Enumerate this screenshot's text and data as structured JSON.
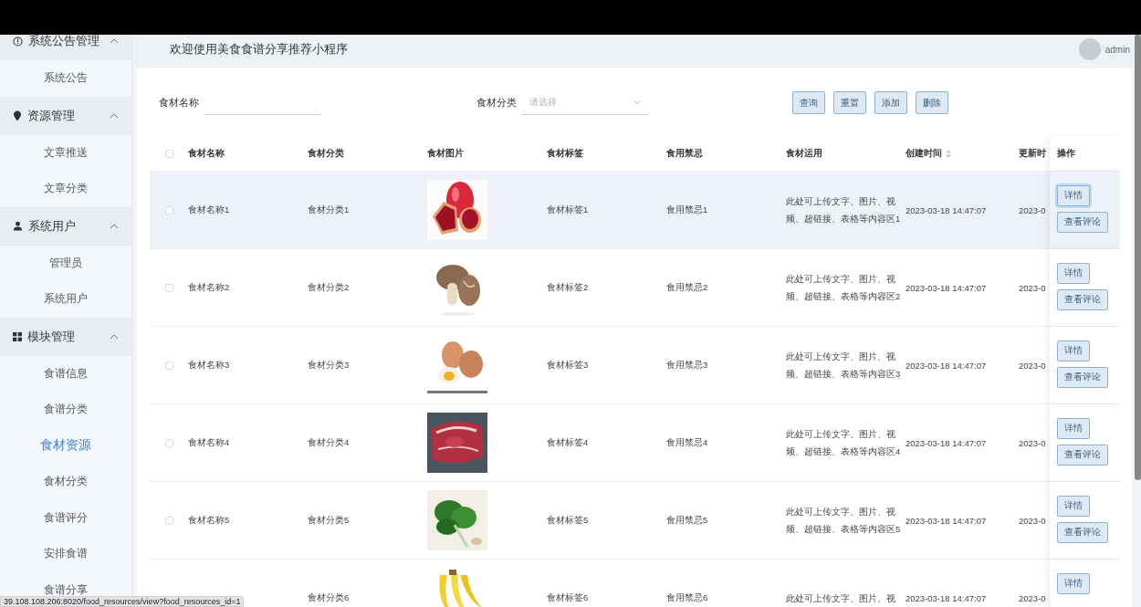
{
  "sidebar": {
    "groups": [
      {
        "label": "系统公告管理",
        "expanded": true,
        "items": [
          {
            "label": "系统公告",
            "selected": false
          }
        ]
      },
      {
        "label": "资源管理",
        "expanded": true,
        "items": [
          {
            "label": "文章推送",
            "selected": false
          },
          {
            "label": "文章分类",
            "selected": false
          }
        ]
      },
      {
        "label": "系统用户",
        "expanded": true,
        "items": [
          {
            "label": "管理员",
            "selected": false
          },
          {
            "label": "系统用户",
            "selected": false
          }
        ]
      },
      {
        "label": "模块管理",
        "expanded": true,
        "items": [
          {
            "label": "食谱信息",
            "selected": false
          },
          {
            "label": "食谱分类",
            "selected": false
          },
          {
            "label": "食材资源",
            "selected": true
          },
          {
            "label": "食材分类",
            "selected": false
          },
          {
            "label": "食谱评分",
            "selected": false
          },
          {
            "label": "安排食谱",
            "selected": false
          },
          {
            "label": "食谱分享",
            "selected": false
          }
        ]
      }
    ]
  },
  "header": {
    "title": "欢迎使用美食食谱分享推荐小程序",
    "user": "admin"
  },
  "filters": {
    "fields": [
      {
        "kind": "input",
        "label": "食材名称"
      },
      {
        "kind": "select",
        "label": "食材分类",
        "placeholder": "请选择"
      }
    ],
    "buttons": [
      "查询",
      "重置",
      "添加",
      "删除"
    ]
  },
  "table": {
    "header_checked": false,
    "columns": [
      {
        "label": "食材名称",
        "sortable": false
      },
      {
        "label": "食材分类",
        "sortable": false
      },
      {
        "label": "食材图片",
        "sortable": false
      },
      {
        "label": "食材标签",
        "sortable": false
      },
      {
        "label": "食用禁忌",
        "sortable": false
      },
      {
        "label": "食材运用",
        "sortable": false
      },
      {
        "label": "创建时间",
        "sortable": true
      },
      {
        "label": "更新时",
        "sortable": false
      },
      {
        "label": "操作",
        "sortable": false
      }
    ],
    "rows": [
      {
        "checked": false,
        "highlighted": true,
        "name": "食材名称1",
        "category": "食材分类1",
        "image": {
          "kind": "picture"
        },
        "tag": "食材标签1",
        "taboo": "食用禁忌1",
        "usage": "此处可上传文字、图片、视频、超链接、表格等内容区1",
        "created": "2023-03-18 14:47:07",
        "updated": "2023-0",
        "actions": [
          {
            "label": "详情",
            "focused": true
          },
          {
            "label": "查看评论",
            "focused": false
          }
        ]
      },
      {
        "checked": false,
        "highlighted": false,
        "name": "食材名称2",
        "category": "食材分类2",
        "image": {
          "kind": "picture"
        },
        "tag": "食材标签2",
        "taboo": "食用禁忌2",
        "usage": "此处可上传文字、图片、视频、超链接、表格等内容区2",
        "created": "2023-03-18 14:47:07",
        "updated": "2023-0",
        "actions": [
          {
            "label": "详情",
            "focused": false
          },
          {
            "label": "查看评论",
            "focused": false
          }
        ]
      },
      {
        "checked": false,
        "highlighted": false,
        "name": "食材名称3",
        "category": "食材分类3",
        "image": {
          "kind": "picture"
        },
        "tag": "食材标签3",
        "taboo": "食用禁忌3",
        "usage": "此处可上传文字、图片、视频、超链接、表格等内容区3",
        "created": "2023-03-18 14:47:07",
        "updated": "2023-0",
        "actions": [
          {
            "label": "详情",
            "focused": false
          },
          {
            "label": "查看评论",
            "focused": false
          }
        ]
      },
      {
        "checked": false,
        "highlighted": false,
        "name": "食材名称4",
        "category": "食材分类4",
        "image": {
          "kind": "picture"
        },
        "tag": "食材标签4",
        "taboo": "食用禁忌4",
        "usage": "此处可上传文字、图片、视频、超链接、表格等内容区4",
        "created": "2023-03-18 14:47:07",
        "updated": "2023-0",
        "actions": [
          {
            "label": "详情",
            "focused": false
          },
          {
            "label": "查看评论",
            "focused": false
          }
        ]
      },
      {
        "checked": false,
        "highlighted": false,
        "name": "食材名称5",
        "category": "食材分类5",
        "image": {
          "kind": "picture"
        },
        "tag": "食材标签5",
        "taboo": "食用禁忌5",
        "usage": "此处可上传文字、图片、视频、超链接、表格等内容区5",
        "created": "2023-03-18 14:47:07",
        "updated": "2023-0",
        "actions": [
          {
            "label": "详情",
            "focused": false
          },
          {
            "label": "查看评论",
            "focused": false
          }
        ]
      },
      {
        "highlighted": false,
        "category": "食材分类6",
        "image": {
          "kind": "picture"
        },
        "tag": "食材标签6",
        "taboo": "食用禁忌6",
        "usage": "此处可上传文字、图片、视",
        "created": "2023-03-18 14:47:07",
        "updated": "2023-0",
        "actions": [
          {
            "label": "详情",
            "focused": false
          }
        ]
      }
    ]
  },
  "status_tip": "39.108.108.206:8020/food_resources/view?food_resources_id=1"
}
